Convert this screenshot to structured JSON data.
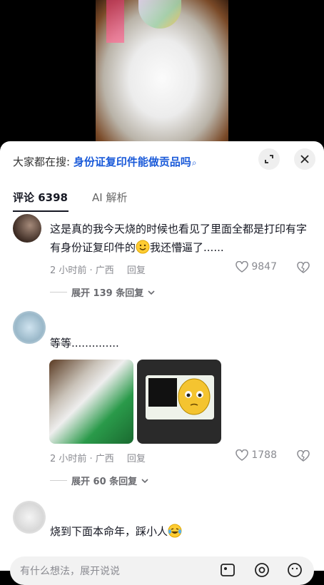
{
  "search": {
    "prefix": "大家都在搜:",
    "query": "身份证复印件能做贡品吗",
    "query_icon": "search-icon"
  },
  "header_buttons": [
    "expand-icon",
    "close-icon"
  ],
  "tabs": [
    {
      "label": "评论 6398",
      "active": true
    },
    {
      "label": "AI 解析",
      "active": false
    }
  ],
  "comments": [
    {
      "text_before": "这是真的我今天烧的时候也看见了里面全都是打印有字有身份证复印件的",
      "emoji": "smile-emoji",
      "text_after": "我还懵逼了......",
      "time_loc": "2 小时前 · 广西",
      "reply_label": "回复",
      "likes": "9847",
      "expand_label": "展开 139 条回复"
    },
    {
      "text": "等等..............",
      "time_loc": "2 小时前 · 广西",
      "reply_label": "回复",
      "likes": "1788",
      "expand_label": "展开 60 条回复"
    },
    {
      "text_before": "烧到下面本命年，踩小人",
      "emoji": "laugh-cry-emoji"
    }
  ],
  "input": {
    "placeholder": "有什么想法，展开说说",
    "icons": [
      "image-icon",
      "at-icon",
      "emoji-icon"
    ]
  }
}
